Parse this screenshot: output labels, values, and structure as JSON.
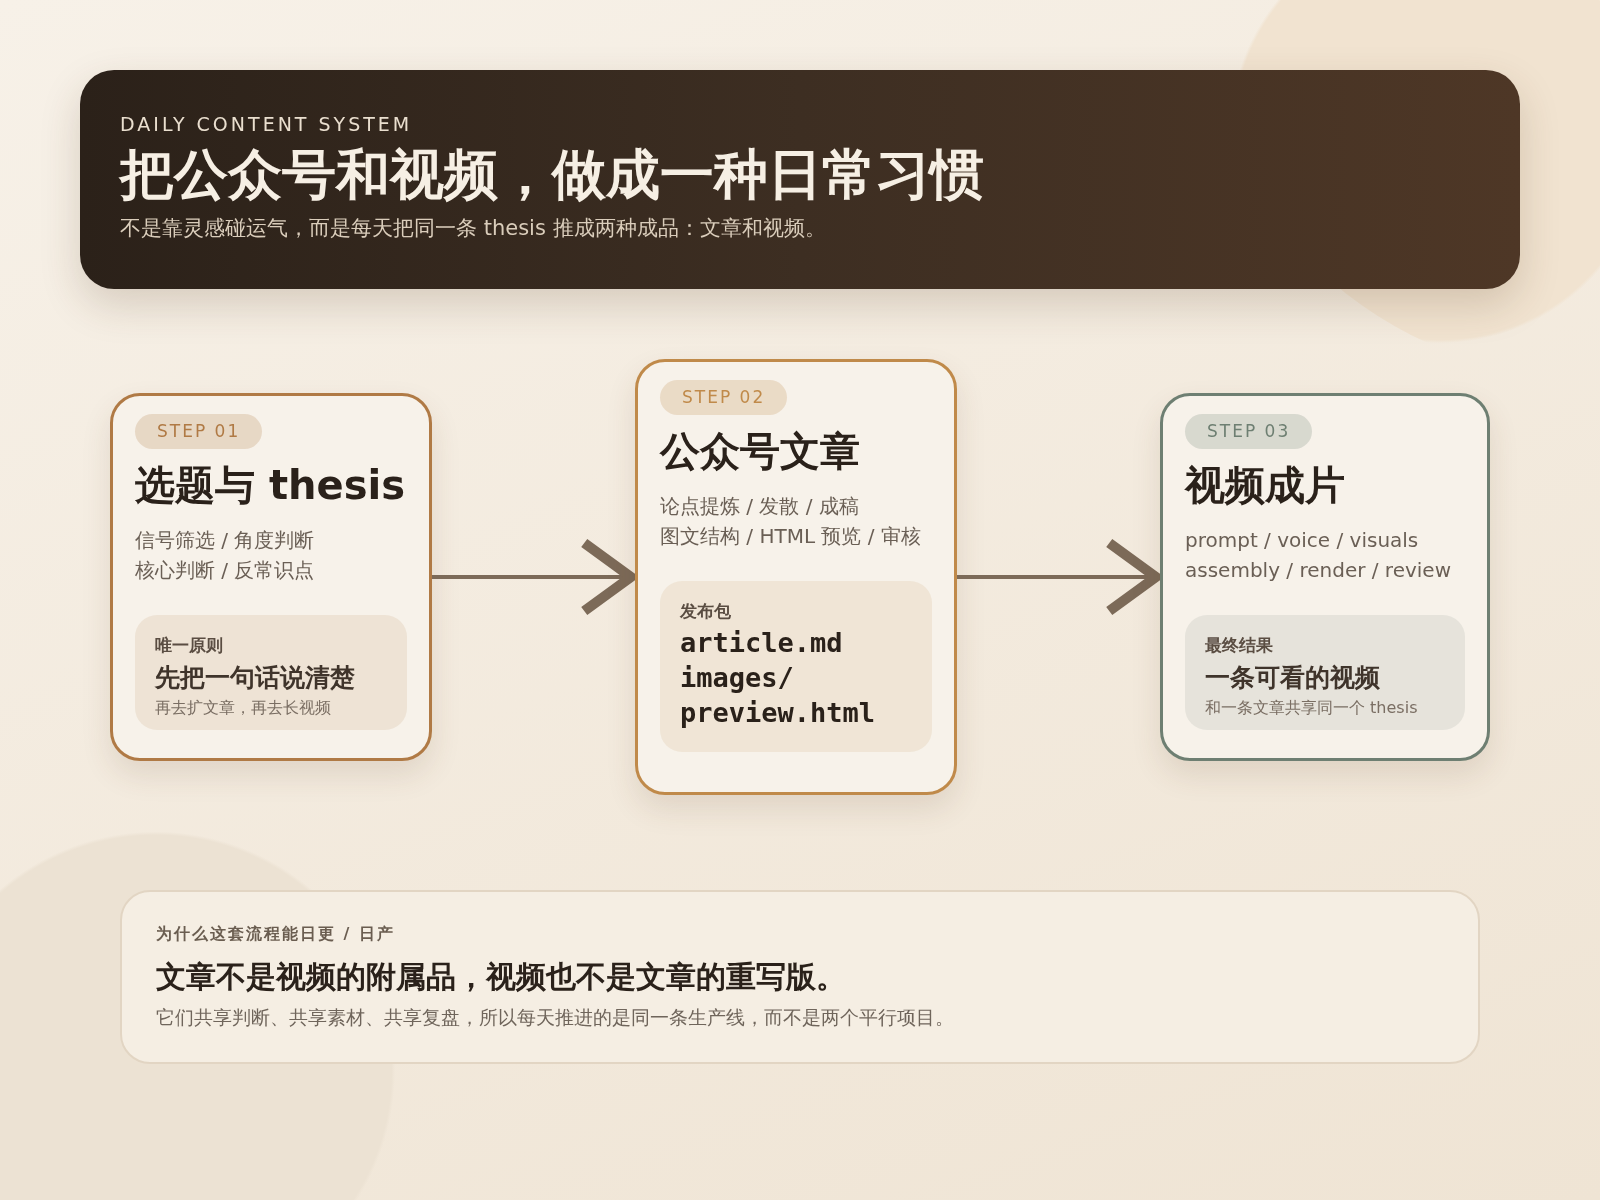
{
  "header": {
    "eyebrow": "DAILY CONTENT SYSTEM",
    "title": "把公众号和视频，做成一种日常习惯",
    "subtitle": "不是靠灵感碰运气，而是每天把同一条 thesis 推成两种成品：文章和视频。"
  },
  "steps": [
    {
      "badge": "STEP 01",
      "title": "选题与 thesis",
      "color": "#b07a45",
      "lines": [
        "信号筛选 / 角度判断",
        "核心判断 / 反常识点"
      ],
      "inset": {
        "kind": "note",
        "label": "唯一原则",
        "headline": "先把一句话说清楚",
        "caption": "再去扩文章，再去长视频"
      }
    },
    {
      "badge": "STEP 02",
      "title": "公众号文章",
      "color": "#c08a4a",
      "lines": [
        "论点提炼 / 发散 / 成稿",
        "图文结构 / HTML 预览 / 审核"
      ],
      "inset": {
        "kind": "files",
        "label": "发布包",
        "files": [
          "article.md",
          "images/",
          "preview.html"
        ]
      }
    },
    {
      "badge": "STEP 03",
      "title": "视频成片",
      "color": "#6e7f72",
      "lines": [
        "prompt / voice / visuals",
        "assembly / render / review"
      ],
      "inset": {
        "kind": "note",
        "label": "最终结果",
        "headline": "一条可看的视频",
        "caption": "和一条文章共享同一个 thesis"
      }
    }
  ],
  "footer": {
    "eyebrow": "为什么这套流程能日更 / 日产",
    "headline": "文章不是视频的附属品，视频也不是文章的重写版。",
    "body": "它们共享判断、共享素材、共享复盘，所以每天推进的是同一条生产线，而不是两个平行项目。"
  }
}
